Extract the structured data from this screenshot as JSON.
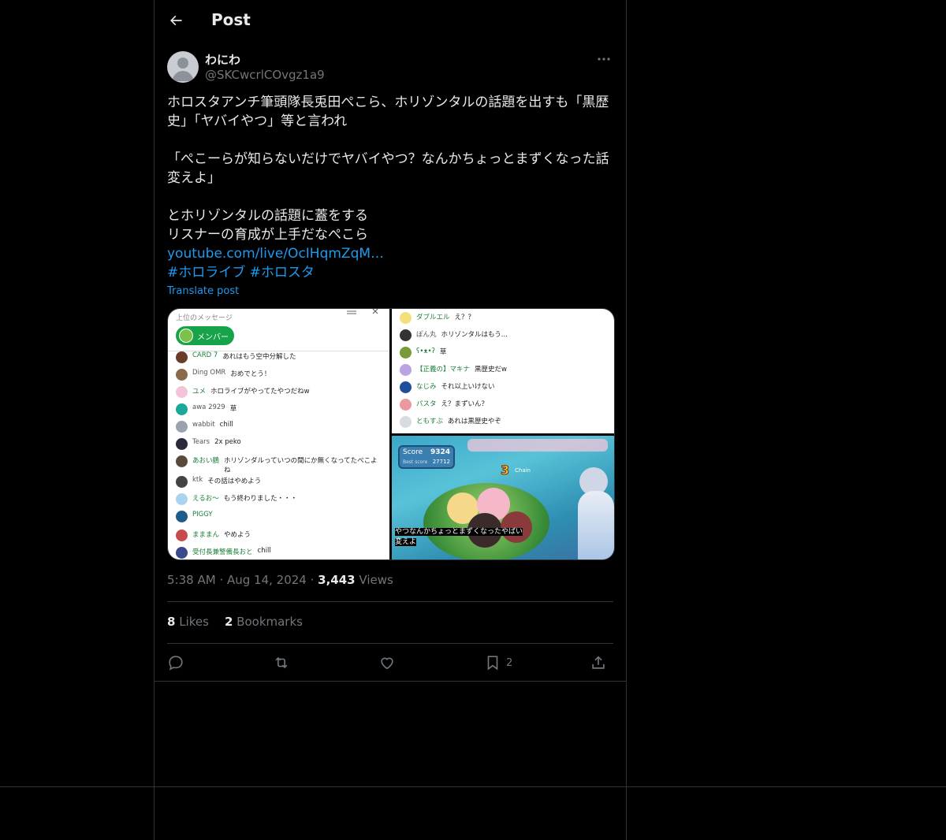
{
  "header": {
    "title": "Post"
  },
  "author": {
    "name": "わにわ",
    "handle": "@SKCwcrlCOvgz1a9"
  },
  "post": {
    "text": "ホロスタアンチ筆頭隊長兎田ぺこら、ホリゾンタルの話題を出すも「黒歴史」「ヤバイやつ」等と言われ\n\n「ぺこーらが知らないだけでヤバイやつ？なんかちょっとまずくなった話変えよ」\n\nとホリゾンタルの話題に蓋をする\nリスナーの育成が上手だなぺこら",
    "link": "youtube.com/live/OcIHqmZqM…",
    "hashtag1": "#ホロライブ",
    "hashtag2": "#ホロスタ",
    "translate": "Translate post"
  },
  "media": {
    "left": {
      "header": "上位のメッセージ",
      "member_label": "メンバー",
      "messages": [
        {
          "name": "CARD 7",
          "msg": "あれはもう空中分解した"
        },
        {
          "name": "Ding OMR",
          "msg": "おめでとう！"
        },
        {
          "name": "ユメ",
          "msg": "ホロライブがやってたやつだねw"
        },
        {
          "name": "awa 2929",
          "msg": "草"
        },
        {
          "name": "wabbit",
          "msg": "chill"
        },
        {
          "name": "Tears",
          "msg": "2x peko"
        },
        {
          "name": "あおい鶴",
          "msg": "ホリゾンダルっていつの間にか無くなってたぺこよね"
        },
        {
          "name": "ktk",
          "msg": "その話はやめよう"
        },
        {
          "name": "えるお～",
          "msg": "もう終わりました・・・"
        },
        {
          "name": "PIGGY",
          "msg": ""
        },
        {
          "name": "まままん",
          "msg": "やめよう"
        },
        {
          "name": "受付長兼警備長おと",
          "msg": "chill"
        }
      ]
    },
    "right_top": {
      "messages": [
        {
          "name": "ダブルエル",
          "msg": "え？？"
        },
        {
          "name": "ぽん丸",
          "msg": "ホリゾンタルはもう..."
        },
        {
          "name": "ʕ•ᴥ•ʔ",
          "msg": "草"
        },
        {
          "name": "【正義の】マキナ",
          "msg": "黒歴史だw"
        },
        {
          "name": "なじみ",
          "msg": "それ以上いけない"
        },
        {
          "name": "パスタ",
          "msg": "え？まずいん？"
        },
        {
          "name": "ともすぶ",
          "msg": "あれは黒歴史やぞ"
        }
      ]
    },
    "right_bottom": {
      "score_label": "Score",
      "score": "9324",
      "best_label": "Best score",
      "best": "27712",
      "combo": "3",
      "combo_label": "Chain",
      "subtitle_line1": "やつなんかちょっとまずくなったやばい",
      "subtitle_line2": "変えよ"
    }
  },
  "meta": {
    "time": "5:38 AM",
    "date": "Aug 14, 2024",
    "views_count": "3,443",
    "views_label": "Views"
  },
  "stats": {
    "likes_count": "8",
    "likes_label": "Likes",
    "bookmarks_count": "2",
    "bookmarks_label": "Bookmarks"
  },
  "actions": {
    "bookmark_count": "2"
  },
  "colors": {
    "background": "#000000",
    "text": "#e7e9ea",
    "secondary": "#71767b",
    "link": "#1d9bf0",
    "border": "#2f3336"
  }
}
